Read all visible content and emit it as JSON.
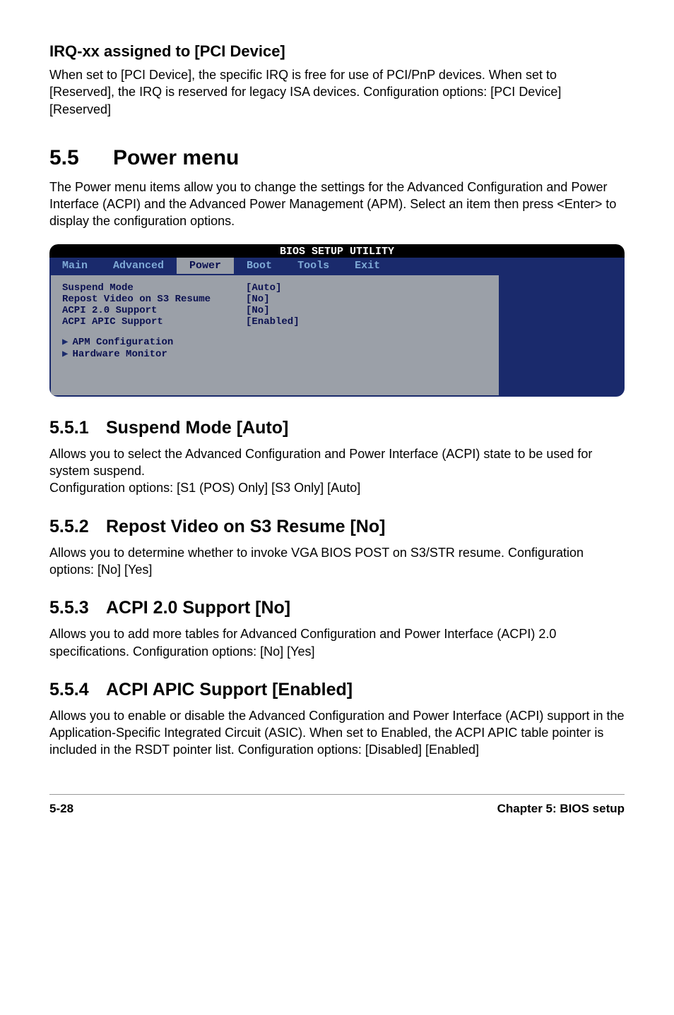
{
  "irq": {
    "heading": "IRQ-xx assigned to [PCI Device]",
    "body": "When set to [PCI Device], the specific IRQ is free for use of PCI/PnP devices. When set to [Reserved], the IRQ is reserved for legacy ISA devices. Configuration options: [PCI Device] [Reserved]"
  },
  "powermenu": {
    "num": "5.5",
    "title": "Power menu",
    "intro": "The Power menu items allow you to change the settings for the Advanced Configuration and Power Interface (ACPI) and the Advanced Power Management (APM). Select an item then press <Enter> to display the configuration options."
  },
  "bios": {
    "title": "BIOS SETUP UTILITY",
    "tabs": [
      "Main",
      "Advanced",
      "Power",
      "Boot",
      "Tools",
      "Exit"
    ],
    "items": [
      {
        "label": "Suspend Mode",
        "value": "[Auto]"
      },
      {
        "label": "Repost Video on S3 Resume",
        "value": "[No]"
      },
      {
        "label": "ACPI 2.0 Support",
        "value": "[No]"
      },
      {
        "label": "ACPI APIC Support",
        "value": "[Enabled]"
      }
    ],
    "subs": [
      "APM Configuration",
      "Hardware Monitor"
    ]
  },
  "sections": [
    {
      "num": "5.5.1",
      "title": "Suspend Mode [Auto]",
      "body": "Allows you to select the Advanced Configuration and Power Interface (ACPI) state to be used for system suspend.\nConfiguration options: [S1 (POS) Only] [S3 Only] [Auto]"
    },
    {
      "num": "5.5.2",
      "title": "Repost Video on S3 Resume [No]",
      "body": "Allows you to determine whether to invoke VGA BIOS POST on S3/STR resume. Configuration options: [No] [Yes]"
    },
    {
      "num": "5.5.3",
      "title": "ACPI 2.0 Support [No]",
      "body": "Allows you to add more tables for Advanced Configuration and Power Interface (ACPI) 2.0 specifications. Configuration options: [No] [Yes]"
    },
    {
      "num": "5.5.4",
      "title": "ACPI APIC Support [Enabled]",
      "body": "Allows you to enable or disable the Advanced Configuration and Power Interface (ACPI) support in the Application-Specific Integrated Circuit (ASIC). When set to Enabled, the ACPI APIC table pointer is included in the RSDT pointer list. Configuration options: [Disabled] [Enabled]"
    }
  ],
  "footer": {
    "page": "5-28",
    "chapter": "Chapter 5: BIOS setup"
  }
}
